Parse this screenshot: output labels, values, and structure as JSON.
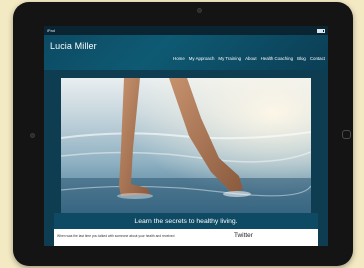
{
  "status_bar": {
    "carrier": "iPad",
    "time": "",
    "battery_level": 0.8
  },
  "site": {
    "title": "Lucia Miller"
  },
  "nav": {
    "items": [
      "Home",
      "My Approach",
      "My Training",
      "About",
      "Health Coaching",
      "Blog",
      "Contact"
    ]
  },
  "hero": {
    "image": "feet-in-ocean-surf-photo"
  },
  "tagline": "Learn the secrets to healthy living.",
  "content": {
    "question": "When was the last time you talked with someone about your health and received",
    "twitter_heading": "Twitter"
  },
  "colors": {
    "page_background": "#f3e9c3",
    "device_bezel": "#141414",
    "header_background": "#0d4a63",
    "tagline_background": "#0e4a63"
  }
}
